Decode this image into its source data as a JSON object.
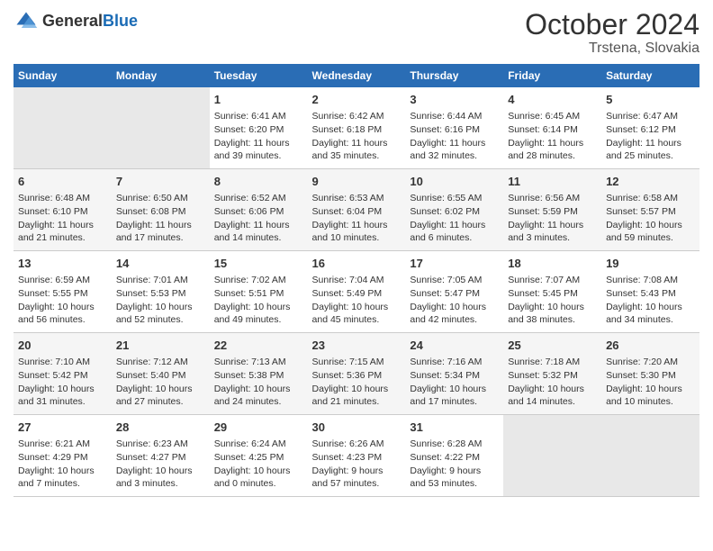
{
  "logo": {
    "general": "General",
    "blue": "Blue"
  },
  "title": "October 2024",
  "subtitle": "Trstena, Slovakia",
  "weekdays": [
    "Sunday",
    "Monday",
    "Tuesday",
    "Wednesday",
    "Thursday",
    "Friday",
    "Saturday"
  ],
  "weeks": [
    [
      {
        "day": "",
        "sunrise": "",
        "sunset": "",
        "daylight": ""
      },
      {
        "day": "",
        "sunrise": "",
        "sunset": "",
        "daylight": ""
      },
      {
        "day": "1",
        "sunrise": "Sunrise: 6:41 AM",
        "sunset": "Sunset: 6:20 PM",
        "daylight": "Daylight: 11 hours and 39 minutes."
      },
      {
        "day": "2",
        "sunrise": "Sunrise: 6:42 AM",
        "sunset": "Sunset: 6:18 PM",
        "daylight": "Daylight: 11 hours and 35 minutes."
      },
      {
        "day": "3",
        "sunrise": "Sunrise: 6:44 AM",
        "sunset": "Sunset: 6:16 PM",
        "daylight": "Daylight: 11 hours and 32 minutes."
      },
      {
        "day": "4",
        "sunrise": "Sunrise: 6:45 AM",
        "sunset": "Sunset: 6:14 PM",
        "daylight": "Daylight: 11 hours and 28 minutes."
      },
      {
        "day": "5",
        "sunrise": "Sunrise: 6:47 AM",
        "sunset": "Sunset: 6:12 PM",
        "daylight": "Daylight: 11 hours and 25 minutes."
      }
    ],
    [
      {
        "day": "6",
        "sunrise": "Sunrise: 6:48 AM",
        "sunset": "Sunset: 6:10 PM",
        "daylight": "Daylight: 11 hours and 21 minutes."
      },
      {
        "day": "7",
        "sunrise": "Sunrise: 6:50 AM",
        "sunset": "Sunset: 6:08 PM",
        "daylight": "Daylight: 11 hours and 17 minutes."
      },
      {
        "day": "8",
        "sunrise": "Sunrise: 6:52 AM",
        "sunset": "Sunset: 6:06 PM",
        "daylight": "Daylight: 11 hours and 14 minutes."
      },
      {
        "day": "9",
        "sunrise": "Sunrise: 6:53 AM",
        "sunset": "Sunset: 6:04 PM",
        "daylight": "Daylight: 11 hours and 10 minutes."
      },
      {
        "day": "10",
        "sunrise": "Sunrise: 6:55 AM",
        "sunset": "Sunset: 6:02 PM",
        "daylight": "Daylight: 11 hours and 6 minutes."
      },
      {
        "day": "11",
        "sunrise": "Sunrise: 6:56 AM",
        "sunset": "Sunset: 5:59 PM",
        "daylight": "Daylight: 11 hours and 3 minutes."
      },
      {
        "day": "12",
        "sunrise": "Sunrise: 6:58 AM",
        "sunset": "Sunset: 5:57 PM",
        "daylight": "Daylight: 10 hours and 59 minutes."
      }
    ],
    [
      {
        "day": "13",
        "sunrise": "Sunrise: 6:59 AM",
        "sunset": "Sunset: 5:55 PM",
        "daylight": "Daylight: 10 hours and 56 minutes."
      },
      {
        "day": "14",
        "sunrise": "Sunrise: 7:01 AM",
        "sunset": "Sunset: 5:53 PM",
        "daylight": "Daylight: 10 hours and 52 minutes."
      },
      {
        "day": "15",
        "sunrise": "Sunrise: 7:02 AM",
        "sunset": "Sunset: 5:51 PM",
        "daylight": "Daylight: 10 hours and 49 minutes."
      },
      {
        "day": "16",
        "sunrise": "Sunrise: 7:04 AM",
        "sunset": "Sunset: 5:49 PM",
        "daylight": "Daylight: 10 hours and 45 minutes."
      },
      {
        "day": "17",
        "sunrise": "Sunrise: 7:05 AM",
        "sunset": "Sunset: 5:47 PM",
        "daylight": "Daylight: 10 hours and 42 minutes."
      },
      {
        "day": "18",
        "sunrise": "Sunrise: 7:07 AM",
        "sunset": "Sunset: 5:45 PM",
        "daylight": "Daylight: 10 hours and 38 minutes."
      },
      {
        "day": "19",
        "sunrise": "Sunrise: 7:08 AM",
        "sunset": "Sunset: 5:43 PM",
        "daylight": "Daylight: 10 hours and 34 minutes."
      }
    ],
    [
      {
        "day": "20",
        "sunrise": "Sunrise: 7:10 AM",
        "sunset": "Sunset: 5:42 PM",
        "daylight": "Daylight: 10 hours and 31 minutes."
      },
      {
        "day": "21",
        "sunrise": "Sunrise: 7:12 AM",
        "sunset": "Sunset: 5:40 PM",
        "daylight": "Daylight: 10 hours and 27 minutes."
      },
      {
        "day": "22",
        "sunrise": "Sunrise: 7:13 AM",
        "sunset": "Sunset: 5:38 PM",
        "daylight": "Daylight: 10 hours and 24 minutes."
      },
      {
        "day": "23",
        "sunrise": "Sunrise: 7:15 AM",
        "sunset": "Sunset: 5:36 PM",
        "daylight": "Daylight: 10 hours and 21 minutes."
      },
      {
        "day": "24",
        "sunrise": "Sunrise: 7:16 AM",
        "sunset": "Sunset: 5:34 PM",
        "daylight": "Daylight: 10 hours and 17 minutes."
      },
      {
        "day": "25",
        "sunrise": "Sunrise: 7:18 AM",
        "sunset": "Sunset: 5:32 PM",
        "daylight": "Daylight: 10 hours and 14 minutes."
      },
      {
        "day": "26",
        "sunrise": "Sunrise: 7:20 AM",
        "sunset": "Sunset: 5:30 PM",
        "daylight": "Daylight: 10 hours and 10 minutes."
      }
    ],
    [
      {
        "day": "27",
        "sunrise": "Sunrise: 6:21 AM",
        "sunset": "Sunset: 4:29 PM",
        "daylight": "Daylight: 10 hours and 7 minutes."
      },
      {
        "day": "28",
        "sunrise": "Sunrise: 6:23 AM",
        "sunset": "Sunset: 4:27 PM",
        "daylight": "Daylight: 10 hours and 3 minutes."
      },
      {
        "day": "29",
        "sunrise": "Sunrise: 6:24 AM",
        "sunset": "Sunset: 4:25 PM",
        "daylight": "Daylight: 10 hours and 0 minutes."
      },
      {
        "day": "30",
        "sunrise": "Sunrise: 6:26 AM",
        "sunset": "Sunset: 4:23 PM",
        "daylight": "Daylight: 9 hours and 57 minutes."
      },
      {
        "day": "31",
        "sunrise": "Sunrise: 6:28 AM",
        "sunset": "Sunset: 4:22 PM",
        "daylight": "Daylight: 9 hours and 53 minutes."
      },
      {
        "day": "",
        "sunrise": "",
        "sunset": "",
        "daylight": ""
      },
      {
        "day": "",
        "sunrise": "",
        "sunset": "",
        "daylight": ""
      }
    ]
  ]
}
